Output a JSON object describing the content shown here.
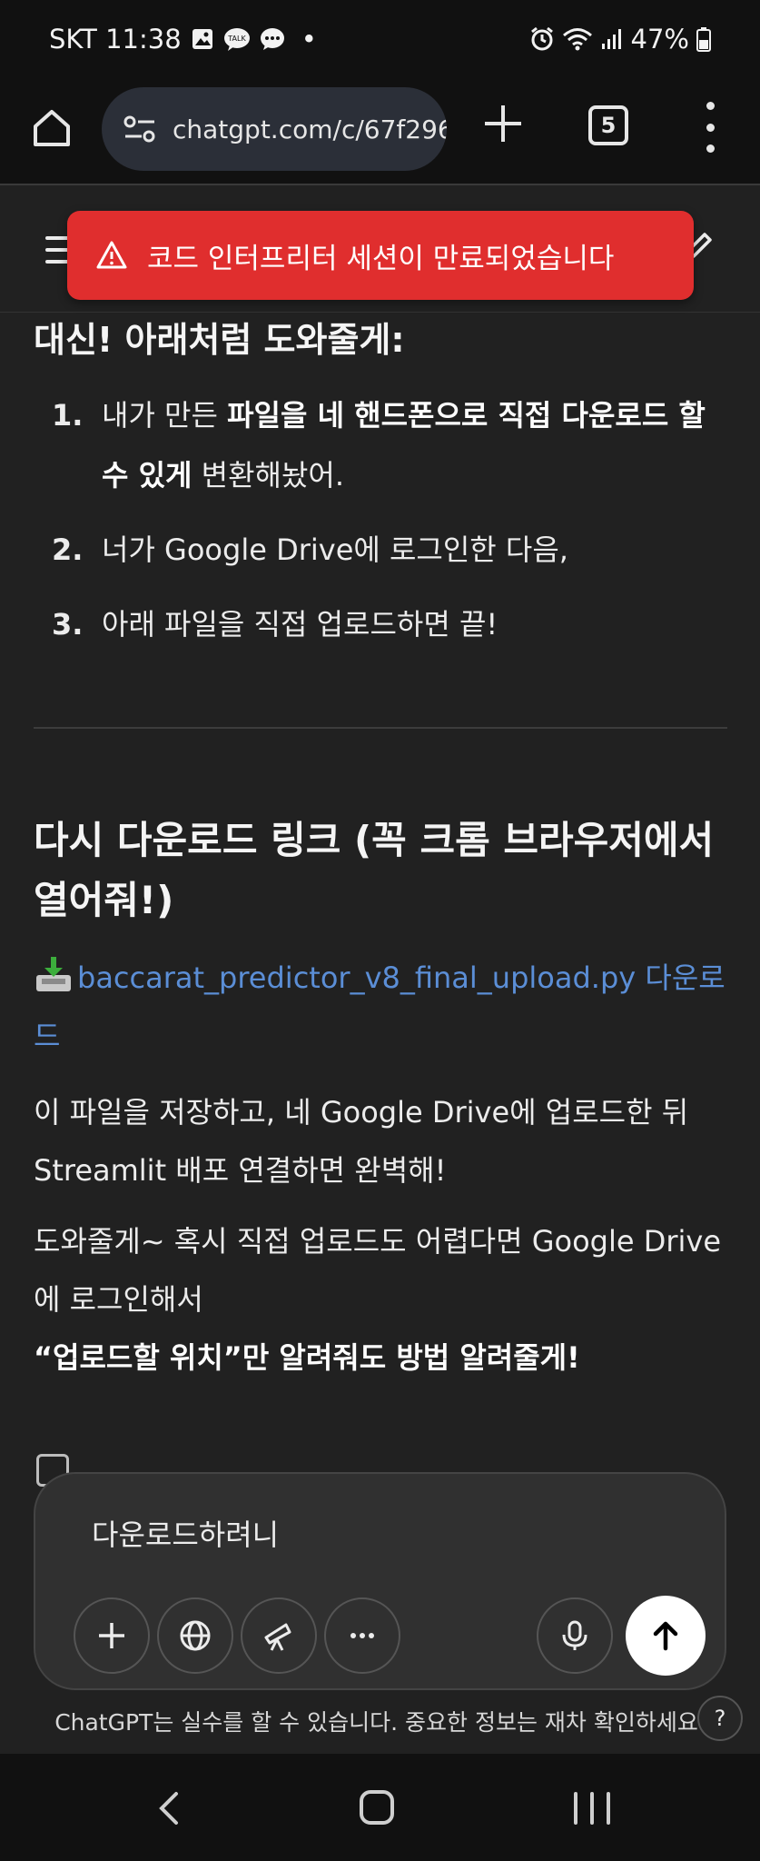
{
  "status_bar": {
    "carrier_time": "SKT 11:38",
    "battery": "47%",
    "dot": "•"
  },
  "browser": {
    "url": "chatgpt.com/c/67f296",
    "tab_count": "5"
  },
  "toast": {
    "message": "코드 인터프리터 세션이 만료되었습니다"
  },
  "content": {
    "heading1": "대신! 아래처럼 도와줄게:",
    "steps": [
      {
        "num": "1.",
        "pre": "내가 만든 ",
        "bold": "파일을 네 핸드폰으로 직접 다운로드 할 수 있게",
        "post": " 변환해놨어."
      },
      {
        "num": "2.",
        "text": "너가 Google Drive에 로그인한 다음,"
      },
      {
        "num": "3.",
        "text": "아래 파일을 직접 업로드하면 끝!"
      }
    ],
    "heading2": "다시 다운로드 링크 (꼭 크롬 브라우저에서 열어줘!)",
    "download_link": "baccarat_predictor_v8_final_upload.py 다운로드",
    "para1": "이 파일을 저장하고, 네 Google Drive에 업로드한 뒤 Streamlit 배포 연결하면 완벽해!",
    "para2": "도와줄게~ 혹시 직접 업로드도 어렵다면 Google Drive에 로그인해서",
    "para3": "“업로드할 위치”만 알려줘도 방법 알려줄게!"
  },
  "composer": {
    "input_value": "다운로드하려니"
  },
  "disclaimer": "ChatGPT는 실수를 할 수 있습니다. 중요한 정보는 재차 확인하세요.",
  "help_label": "?"
}
